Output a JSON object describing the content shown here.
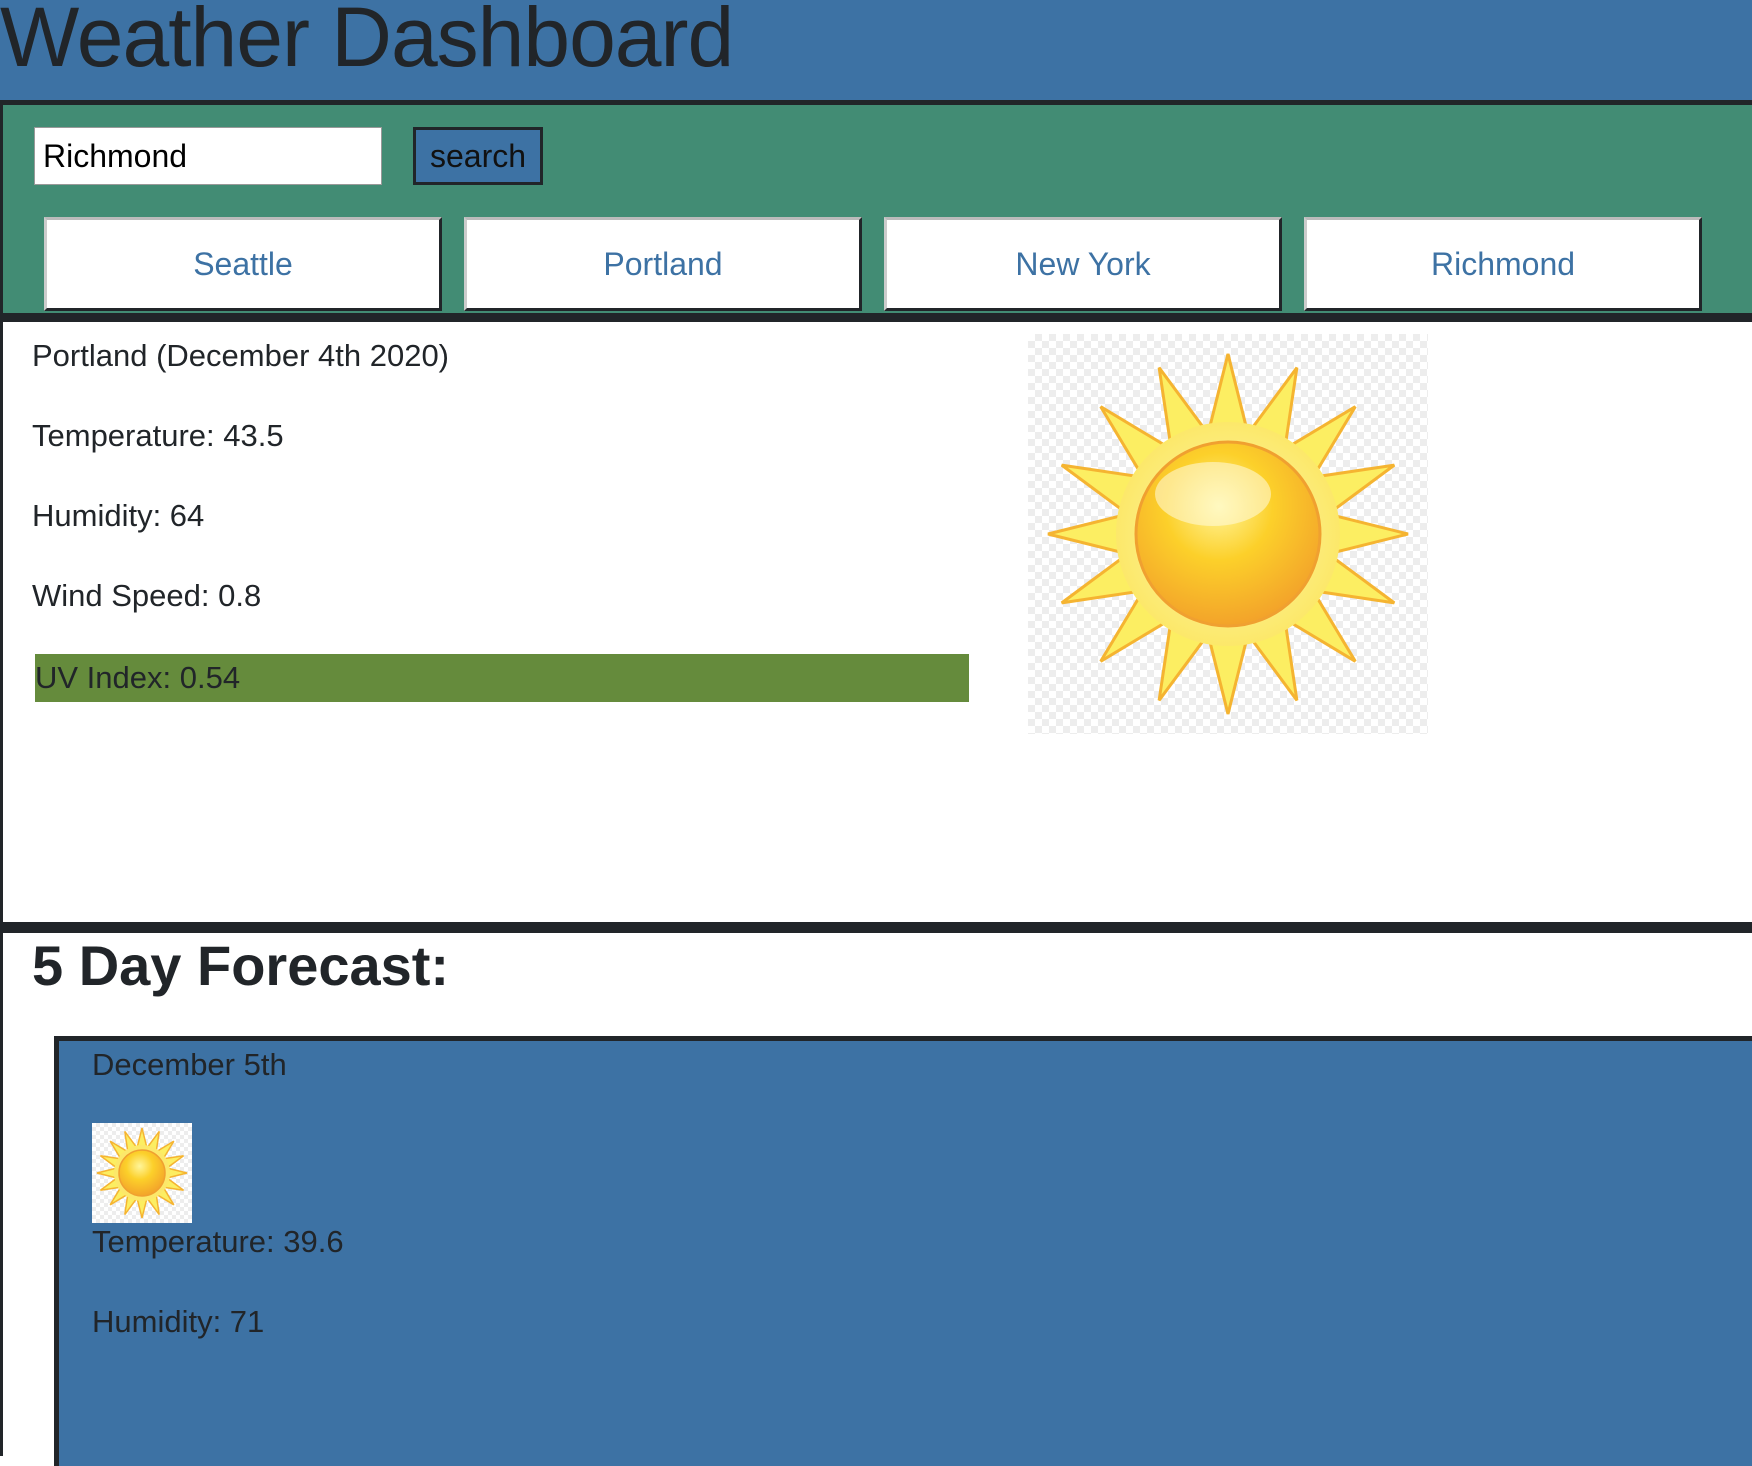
{
  "header": {
    "title": "Weather Dashboard"
  },
  "search": {
    "value": "Richmond",
    "button_label": "search"
  },
  "history": {
    "cities": [
      "Seattle",
      "Portland",
      "New York",
      "Richmond"
    ]
  },
  "current": {
    "city_date": "Portland (December 4th 2020)",
    "temperature": "Temperature: 43.5",
    "humidity": "Humidity: 64",
    "wind_speed": "Wind Speed: 0.8",
    "uv_index": "UV Index: 0.54",
    "uv_color": "#658b3c",
    "icon": "sun-icon"
  },
  "forecast": {
    "heading": "5 Day Forecast:",
    "days": [
      {
        "date": "December 5th",
        "icon": "sun-icon",
        "temperature": "Temperature: 39.6",
        "humidity": "Humidity: 71"
      }
    ]
  },
  "colors": {
    "header_bg": "#3d72a4",
    "search_panel_bg": "#428c74",
    "forecast_card_bg": "#3d72a4",
    "link_text": "#3d72a4"
  }
}
